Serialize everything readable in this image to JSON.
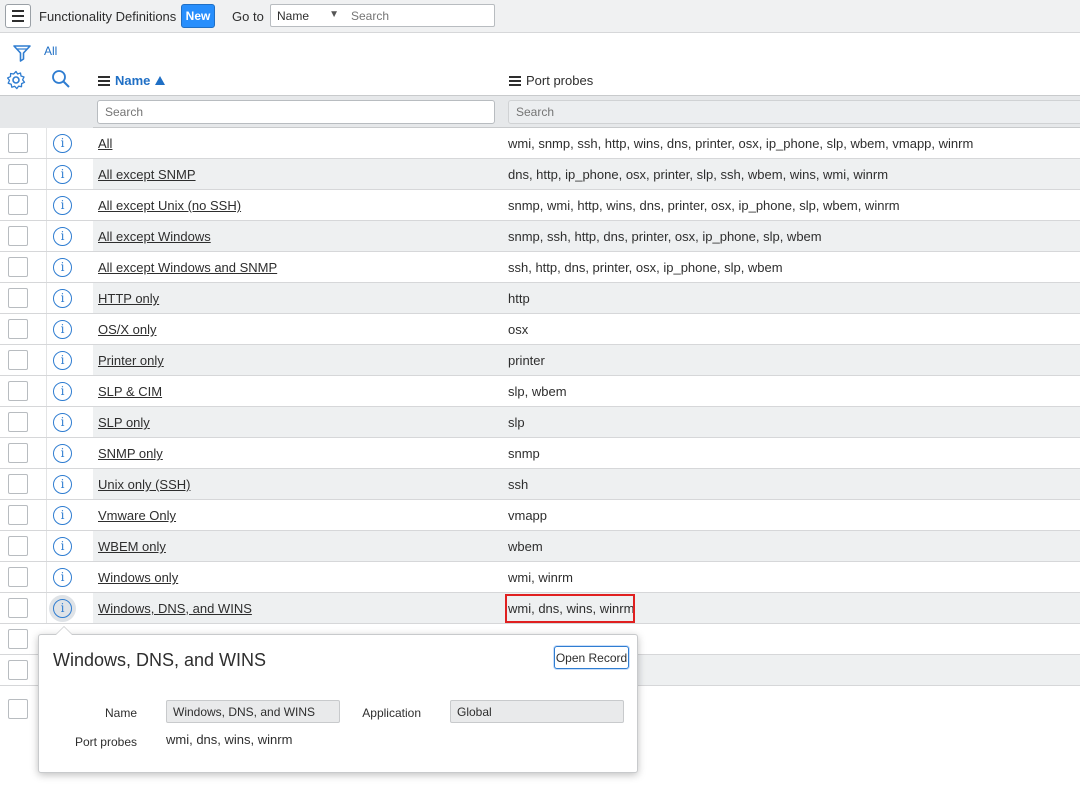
{
  "header": {
    "title": "Functionality Definitions",
    "new_label": "New",
    "goto_label": "Go to",
    "goto_field": "Name",
    "search_placeholder": "Search"
  },
  "breadcrumb": {
    "label": "All"
  },
  "columns": {
    "name": "Name",
    "probes": "Port probes"
  },
  "search_row": {
    "name_placeholder": "Search",
    "probes_placeholder": "Search"
  },
  "rows": [
    {
      "name": "All",
      "probes": "wmi, snmp, ssh, http, wins, dns, printer, osx, ip_phone, slp, wbem, vmapp, winrm"
    },
    {
      "name": "All except SNMP",
      "probes": "dns, http, ip_phone, osx, printer, slp, ssh, wbem, wins, wmi, winrm"
    },
    {
      "name": "All except Unix (no SSH)",
      "probes": "snmp, wmi, http, wins, dns, printer, osx, ip_phone, slp, wbem, winrm"
    },
    {
      "name": "All except Windows",
      "probes": "snmp, ssh, http, dns, printer, osx, ip_phone, slp, wbem"
    },
    {
      "name": "All except Windows and SNMP",
      "probes": "ssh, http, dns, printer, osx, ip_phone, slp, wbem"
    },
    {
      "name": "HTTP only",
      "probes": "http"
    },
    {
      "name": "OS/X only",
      "probes": "osx"
    },
    {
      "name": "Printer only",
      "probes": "printer"
    },
    {
      "name": "SLP & CIM",
      "probes": "slp, wbem"
    },
    {
      "name": "SLP only",
      "probes": "slp"
    },
    {
      "name": "SNMP only",
      "probes": "snmp"
    },
    {
      "name": "Unix only (SSH)",
      "probes": "ssh"
    },
    {
      "name": "Vmware Only",
      "probes": "vmapp"
    },
    {
      "name": "WBEM only",
      "probes": "wbem"
    },
    {
      "name": "Windows only",
      "probes": "wmi, winrm"
    },
    {
      "name": "Windows, DNS, and WINS",
      "probes": "wmi, dns, wins, winrm"
    }
  ],
  "popup": {
    "title": "Windows, DNS, and WINS",
    "open_record_label": "Open Record",
    "name_label": "Name",
    "name_value": "Windows, DNS, and WINS",
    "application_label": "Application",
    "application_value": "Global",
    "probes_label": "Port probes",
    "probes_value": "wmi, dns, wins, winrm"
  },
  "colors": {
    "accent": "#278efc",
    "link": "#1f6fc5",
    "highlight": "#e02020"
  }
}
